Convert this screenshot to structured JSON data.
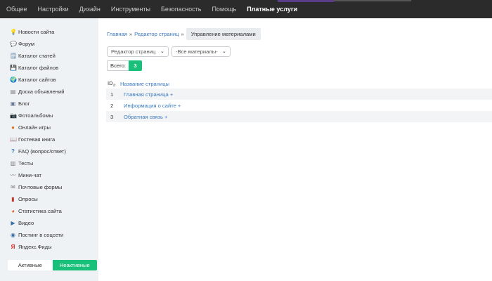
{
  "topnav": {
    "items": [
      "Общее",
      "Настройки",
      "Дизайн",
      "Инструменты",
      "Безопасность",
      "Помощь",
      "Платные услуги"
    ]
  },
  "sidebar": {
    "items": [
      {
        "label": "Новости сайта",
        "icon": "lightbulb-icon"
      },
      {
        "label": "Форум",
        "icon": "speech-bubble-icon"
      },
      {
        "label": "Каталог статей",
        "icon": "notepad-icon"
      },
      {
        "label": "Каталог файлов",
        "icon": "save-disk-icon"
      },
      {
        "label": "Каталог сайтов",
        "icon": "globe-icon"
      },
      {
        "label": "Доска объявлений",
        "icon": "board-icon"
      },
      {
        "label": "Блог",
        "icon": "blog-icon"
      },
      {
        "label": "Фотоальбомы",
        "icon": "camera-icon"
      },
      {
        "label": "Онлайн игры",
        "icon": "game-icon"
      },
      {
        "label": "Гостевая книга",
        "icon": "book-icon"
      },
      {
        "label": "FAQ (вопрос/ответ)",
        "icon": "question-icon"
      },
      {
        "label": "Тесты",
        "icon": "test-icon"
      },
      {
        "label": "Мини-чат",
        "icon": "chat-icon"
      },
      {
        "label": "Почтовые формы",
        "icon": "mail-icon"
      },
      {
        "label": "Опросы",
        "icon": "poll-icon"
      },
      {
        "label": "Статистика сайта",
        "icon": "stats-icon"
      },
      {
        "label": "Видео",
        "icon": "video-icon"
      },
      {
        "label": "Постинг в соцсети",
        "icon": "share-icon"
      },
      {
        "label": "Яндекс.Фиды",
        "icon": "yandex-icon"
      }
    ],
    "toggle": {
      "inactive_left": "Активные",
      "active_right": "Неактивные"
    }
  },
  "breadcrumb": {
    "home": "Главная",
    "section": "Редактор страниц",
    "current": "Управление материалами",
    "separator": "»"
  },
  "filters": {
    "module_select": "Редактор страниц",
    "material_select": "-Все материалы-"
  },
  "total": {
    "label": "Всего:",
    "count": "3"
  },
  "table": {
    "headers": {
      "id": "ID",
      "title": "Название страницы"
    },
    "rows": [
      {
        "id": "1",
        "name": "Главная страница +"
      },
      {
        "id": "2",
        "name": "Информация о сайте +"
      },
      {
        "id": "3",
        "name": "Обратная связь +"
      }
    ]
  },
  "colors": {
    "accent": "#19c07a",
    "link": "#3a7ac0",
    "topbar": "#2b2b2b"
  }
}
